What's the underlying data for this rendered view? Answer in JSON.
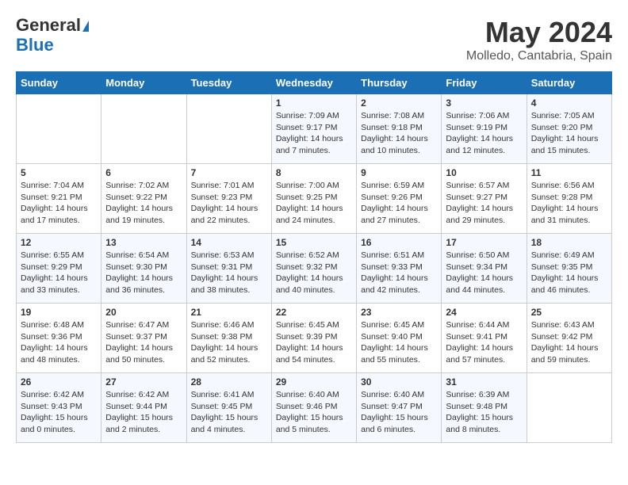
{
  "header": {
    "logo_line1": "General",
    "logo_line2": "Blue",
    "month_year": "May 2024",
    "location": "Molledo, Cantabria, Spain"
  },
  "weekdays": [
    "Sunday",
    "Monday",
    "Tuesday",
    "Wednesday",
    "Thursday",
    "Friday",
    "Saturday"
  ],
  "weeks": [
    [
      {
        "day": "",
        "sunrise": "",
        "sunset": "",
        "daylight": ""
      },
      {
        "day": "",
        "sunrise": "",
        "sunset": "",
        "daylight": ""
      },
      {
        "day": "",
        "sunrise": "",
        "sunset": "",
        "daylight": ""
      },
      {
        "day": "1",
        "sunrise": "Sunrise: 7:09 AM",
        "sunset": "Sunset: 9:17 PM",
        "daylight": "Daylight: 14 hours and 7 minutes."
      },
      {
        "day": "2",
        "sunrise": "Sunrise: 7:08 AM",
        "sunset": "Sunset: 9:18 PM",
        "daylight": "Daylight: 14 hours and 10 minutes."
      },
      {
        "day": "3",
        "sunrise": "Sunrise: 7:06 AM",
        "sunset": "Sunset: 9:19 PM",
        "daylight": "Daylight: 14 hours and 12 minutes."
      },
      {
        "day": "4",
        "sunrise": "Sunrise: 7:05 AM",
        "sunset": "Sunset: 9:20 PM",
        "daylight": "Daylight: 14 hours and 15 minutes."
      }
    ],
    [
      {
        "day": "5",
        "sunrise": "Sunrise: 7:04 AM",
        "sunset": "Sunset: 9:21 PM",
        "daylight": "Daylight: 14 hours and 17 minutes."
      },
      {
        "day": "6",
        "sunrise": "Sunrise: 7:02 AM",
        "sunset": "Sunset: 9:22 PM",
        "daylight": "Daylight: 14 hours and 19 minutes."
      },
      {
        "day": "7",
        "sunrise": "Sunrise: 7:01 AM",
        "sunset": "Sunset: 9:23 PM",
        "daylight": "Daylight: 14 hours and 22 minutes."
      },
      {
        "day": "8",
        "sunrise": "Sunrise: 7:00 AM",
        "sunset": "Sunset: 9:25 PM",
        "daylight": "Daylight: 14 hours and 24 minutes."
      },
      {
        "day": "9",
        "sunrise": "Sunrise: 6:59 AM",
        "sunset": "Sunset: 9:26 PM",
        "daylight": "Daylight: 14 hours and 27 minutes."
      },
      {
        "day": "10",
        "sunrise": "Sunrise: 6:57 AM",
        "sunset": "Sunset: 9:27 PM",
        "daylight": "Daylight: 14 hours and 29 minutes."
      },
      {
        "day": "11",
        "sunrise": "Sunrise: 6:56 AM",
        "sunset": "Sunset: 9:28 PM",
        "daylight": "Daylight: 14 hours and 31 minutes."
      }
    ],
    [
      {
        "day": "12",
        "sunrise": "Sunrise: 6:55 AM",
        "sunset": "Sunset: 9:29 PM",
        "daylight": "Daylight: 14 hours and 33 minutes."
      },
      {
        "day": "13",
        "sunrise": "Sunrise: 6:54 AM",
        "sunset": "Sunset: 9:30 PM",
        "daylight": "Daylight: 14 hours and 36 minutes."
      },
      {
        "day": "14",
        "sunrise": "Sunrise: 6:53 AM",
        "sunset": "Sunset: 9:31 PM",
        "daylight": "Daylight: 14 hours and 38 minutes."
      },
      {
        "day": "15",
        "sunrise": "Sunrise: 6:52 AM",
        "sunset": "Sunset: 9:32 PM",
        "daylight": "Daylight: 14 hours and 40 minutes."
      },
      {
        "day": "16",
        "sunrise": "Sunrise: 6:51 AM",
        "sunset": "Sunset: 9:33 PM",
        "daylight": "Daylight: 14 hours and 42 minutes."
      },
      {
        "day": "17",
        "sunrise": "Sunrise: 6:50 AM",
        "sunset": "Sunset: 9:34 PM",
        "daylight": "Daylight: 14 hours and 44 minutes."
      },
      {
        "day": "18",
        "sunrise": "Sunrise: 6:49 AM",
        "sunset": "Sunset: 9:35 PM",
        "daylight": "Daylight: 14 hours and 46 minutes."
      }
    ],
    [
      {
        "day": "19",
        "sunrise": "Sunrise: 6:48 AM",
        "sunset": "Sunset: 9:36 PM",
        "daylight": "Daylight: 14 hours and 48 minutes."
      },
      {
        "day": "20",
        "sunrise": "Sunrise: 6:47 AM",
        "sunset": "Sunset: 9:37 PM",
        "daylight": "Daylight: 14 hours and 50 minutes."
      },
      {
        "day": "21",
        "sunrise": "Sunrise: 6:46 AM",
        "sunset": "Sunset: 9:38 PM",
        "daylight": "Daylight: 14 hours and 52 minutes."
      },
      {
        "day": "22",
        "sunrise": "Sunrise: 6:45 AM",
        "sunset": "Sunset: 9:39 PM",
        "daylight": "Daylight: 14 hours and 54 minutes."
      },
      {
        "day": "23",
        "sunrise": "Sunrise: 6:45 AM",
        "sunset": "Sunset: 9:40 PM",
        "daylight": "Daylight: 14 hours and 55 minutes."
      },
      {
        "day": "24",
        "sunrise": "Sunrise: 6:44 AM",
        "sunset": "Sunset: 9:41 PM",
        "daylight": "Daylight: 14 hours and 57 minutes."
      },
      {
        "day": "25",
        "sunrise": "Sunrise: 6:43 AM",
        "sunset": "Sunset: 9:42 PM",
        "daylight": "Daylight: 14 hours and 59 minutes."
      }
    ],
    [
      {
        "day": "26",
        "sunrise": "Sunrise: 6:42 AM",
        "sunset": "Sunset: 9:43 PM",
        "daylight": "Daylight: 15 hours and 0 minutes."
      },
      {
        "day": "27",
        "sunrise": "Sunrise: 6:42 AM",
        "sunset": "Sunset: 9:44 PM",
        "daylight": "Daylight: 15 hours and 2 minutes."
      },
      {
        "day": "28",
        "sunrise": "Sunrise: 6:41 AM",
        "sunset": "Sunset: 9:45 PM",
        "daylight": "Daylight: 15 hours and 4 minutes."
      },
      {
        "day": "29",
        "sunrise": "Sunrise: 6:40 AM",
        "sunset": "Sunset: 9:46 PM",
        "daylight": "Daylight: 15 hours and 5 minutes."
      },
      {
        "day": "30",
        "sunrise": "Sunrise: 6:40 AM",
        "sunset": "Sunset: 9:47 PM",
        "daylight": "Daylight: 15 hours and 6 minutes."
      },
      {
        "day": "31",
        "sunrise": "Sunrise: 6:39 AM",
        "sunset": "Sunset: 9:48 PM",
        "daylight": "Daylight: 15 hours and 8 minutes."
      },
      {
        "day": "",
        "sunrise": "",
        "sunset": "",
        "daylight": ""
      }
    ]
  ]
}
